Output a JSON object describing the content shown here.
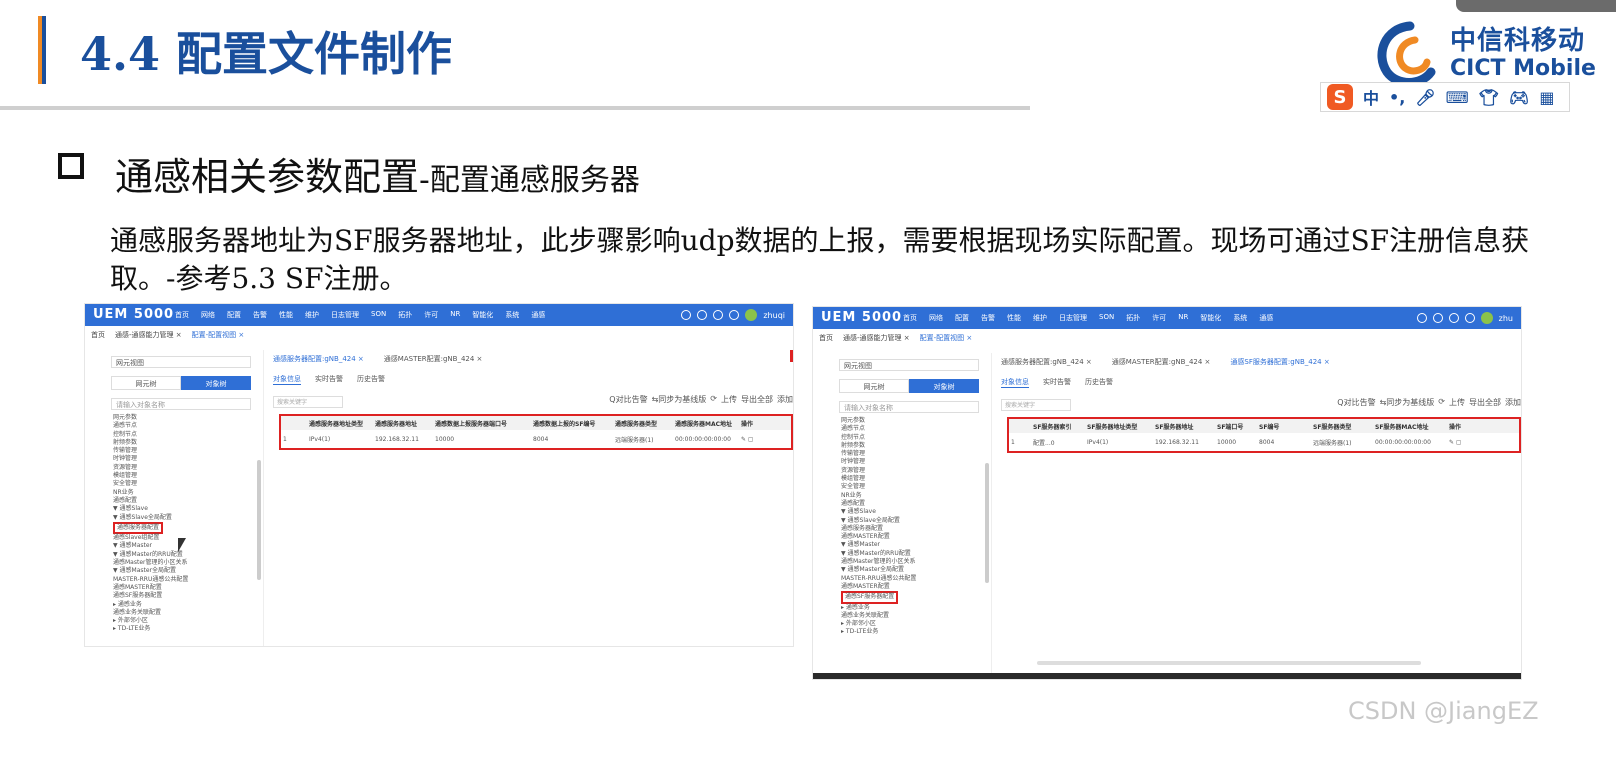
{
  "slide": {
    "title": "4.4 配置文件制作",
    "heading_main": "通感相关参数配置",
    "heading_sub": "-配置通感服务器",
    "paragraph": "通感服务器地址为SF服务器地址，此步骤影响udp数据的上报，需要根据现场实际配置。现场可通过SF注册信息获取。-参考5.3 SF注册。",
    "watermark": "CSDN @JiangEZ"
  },
  "logo": {
    "cn": "中信科移动",
    "en": "CICT Mobile",
    "colors": {
      "blue": "#1a4f9c",
      "orange": "#f08a24"
    }
  },
  "ime_toolbar": {
    "badge": "S",
    "items": [
      "中",
      "•,",
      "mic-icon",
      "keyboard-icon",
      "shirt-icon",
      "game-icon",
      "grid-icon"
    ]
  },
  "screenshot_left": {
    "brand": "UEM 5000",
    "nav": [
      "首页",
      "网络",
      "配置",
      "告警",
      "性能",
      "维护",
      "日志管理",
      "SON",
      "拓扑",
      "许可",
      "NR",
      "智能化",
      "系统",
      "通感"
    ],
    "user": "zhuqi",
    "breadcrumbs": [
      "首页",
      "通感-通感能力管理 ×",
      "配置-配置视图 ×"
    ],
    "side_select": "网元视图",
    "side_toggles": [
      "网元树",
      "对象树"
    ],
    "side_search_placeholder": "请输入对象名称",
    "tree": [
      "网元参数",
      "通感节点",
      "控制节点",
      "射频参数",
      "传输管理",
      "时钟管理",
      "资源管理",
      "模组管理",
      "安全管理",
      "NR业务",
      "通感配置",
      "▼ 通感Slave",
      "  ▼ 通感Slave全局配置",
      "     通感服务器配置",
      "     通感Slave组配置",
      "▼ 通感Master",
      "  ▼ 通感Master的RRU配置",
      "     通感Master管理的小区关系",
      "  ▼ 通感Master全局配置",
      "     MASTER-RRU通感公共配置",
      "     通感MASTER配置",
      "     通感SF服务器配置",
      "▸ 通感业务",
      "  通感业务关联配置",
      "▸ 外部邻小区",
      "▸ TD-LTE业务"
    ],
    "tabs": [
      "通感服务器配置:gNB_424 ×",
      "通感MASTER配置:gNB_424 ×"
    ],
    "subtabs": [
      "对象信息",
      "实时告警",
      "历史告警"
    ],
    "search_placeholder": "搜索关键字",
    "tools": [
      "Q对比告警",
      "⇆同步为基线版",
      "⟳",
      "上传",
      "导出全部",
      "添加"
    ],
    "columns": [
      "",
      "通感服务器地址类型",
      "通感服务器地址",
      "通感数据上报服务器端口号",
      "通感数据上报的SF编号",
      "通感服务器类型",
      "通感服务器MAC地址",
      "操作"
    ],
    "rows": [
      [
        "1",
        "IPv4(1)",
        "192.168.32.11",
        "10000",
        "8004",
        "远端服务器(1)",
        "00:00:00:00:00:00",
        "✎ ▢"
      ]
    ]
  },
  "screenshot_right": {
    "brand": "UEM 5000",
    "nav": [
      "首页",
      "网络",
      "配置",
      "告警",
      "性能",
      "维护",
      "日志管理",
      "SON",
      "拓扑",
      "许可",
      "NR",
      "智能化",
      "系统",
      "通感"
    ],
    "user": "zhu",
    "breadcrumbs": [
      "首页",
      "通感-通感能力管理 ×",
      "配置-配置视图 ×"
    ],
    "side_select": "网元视图",
    "side_toggles": [
      "网元树",
      "对象树"
    ],
    "side_search_placeholder": "请输入对象名称",
    "tree": [
      "网元参数",
      "通感节点",
      "控制节点",
      "射频参数",
      "传输管理",
      "时钟管理",
      "资源管理",
      "模组管理",
      "安全管理",
      "NR业务",
      "通感配置",
      "▼ 通感Slave",
      "  ▼ 通感Slave全局配置",
      "     通感服务器配置",
      "     通感MASTER配置",
      "▼ 通感Master",
      "  ▼ 通感Master的RRU配置",
      "     通感Master管理的小区关系",
      "  ▼ 通感Master全局配置",
      "     MASTER-RRU通感公共配置",
      "     通感MASTER配置",
      "     通感SF服务器配置",
      "▸ 通感业务",
      "  通感业务关联配置",
      "▸ 外部邻小区",
      "▸ TD-LTE业务"
    ],
    "tabs": [
      "通感服务器配置:gNB_424 ×",
      "通感MASTER配置:gNB_424 ×",
      "通感SF服务器配置:gNB_424 ×"
    ],
    "subtabs": [
      "对象信息",
      "实时告警",
      "历史告警"
    ],
    "search_placeholder": "搜索关键字",
    "tools": [
      "Q对比告警",
      "⇆同步为基线版",
      "⟳",
      "上传",
      "导出全部",
      "添加"
    ],
    "columns": [
      "",
      "SF服务器索引",
      "SF服务器地址类型",
      "SF服务器地址",
      "SF端口号",
      "SF编号",
      "SF服务器类型",
      "SF服务器MAC地址",
      "操作"
    ],
    "rows": [
      [
        "1",
        "配置...0",
        "IPv4(1)",
        "192.168.32.11",
        "10000",
        "8004",
        "远端服务器(1)",
        "00:00:00:00:00:00",
        "✎ ▢"
      ]
    ]
  }
}
